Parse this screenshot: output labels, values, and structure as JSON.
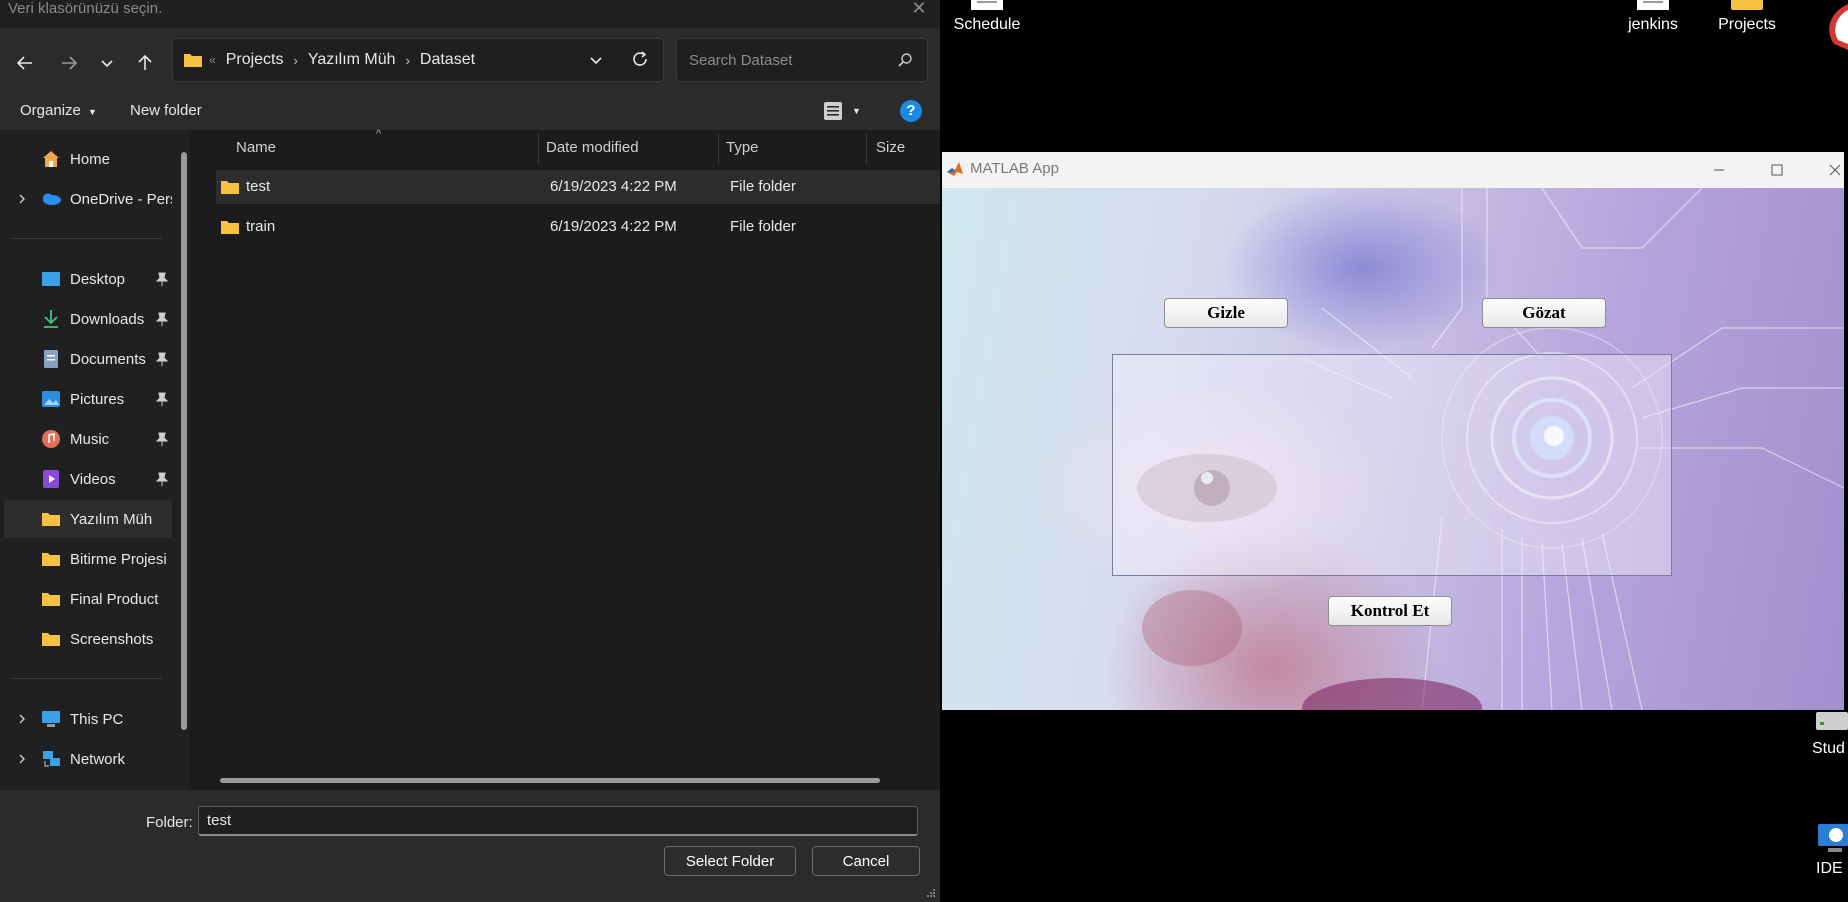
{
  "dialog": {
    "title": "Veri klasörünüzü seçin.",
    "breadcrumb": [
      "Projects",
      "Yazılım Müh",
      "Dataset"
    ],
    "search_placeholder": "Search Dataset",
    "toolbar": {
      "organize": "Organize",
      "new_folder": "New folder"
    },
    "sidebar": {
      "top": [
        {
          "label": "Home",
          "icon": "home-icon"
        },
        {
          "label": "OneDrive - Perso",
          "icon": "onedrive-icon"
        }
      ],
      "quick": [
        {
          "label": "Desktop",
          "icon": "desktop-icon"
        },
        {
          "label": "Downloads",
          "icon": "downloads-icon"
        },
        {
          "label": "Documents",
          "icon": "documents-icon"
        },
        {
          "label": "Pictures",
          "icon": "pictures-icon"
        },
        {
          "label": "Music",
          "icon": "music-icon"
        },
        {
          "label": "Videos",
          "icon": "videos-icon"
        },
        {
          "label": "Yazılım Müh",
          "icon": "folder-icon"
        },
        {
          "label": "Bitirme Projesi",
          "icon": "folder-icon"
        },
        {
          "label": "Final Product",
          "icon": "folder-icon"
        },
        {
          "label": "Screenshots",
          "icon": "folder-icon"
        }
      ],
      "bottom": [
        {
          "label": "This PC",
          "icon": "pc-icon"
        },
        {
          "label": "Network",
          "icon": "network-icon"
        }
      ]
    },
    "columns": [
      "Name",
      "Date modified",
      "Type",
      "Size"
    ],
    "rows": [
      {
        "name": "test",
        "date": "6/19/2023 4:22 PM",
        "type": "File folder",
        "size": ""
      },
      {
        "name": "train",
        "date": "6/19/2023 4:22 PM",
        "type": "File folder",
        "size": ""
      }
    ],
    "footer": {
      "folder_label": "Folder:",
      "folder_value": "test",
      "select_button": "Select Folder",
      "cancel_button": "Cancel"
    }
  },
  "matlab": {
    "title": "MATLAB App",
    "buttons": {
      "gizle": "Gizle",
      "gozat": "Gözat",
      "kontrol": "Kontrol Et"
    }
  },
  "desktop": {
    "icons": [
      "Schedule",
      "jenkins",
      "Projects",
      "Stud",
      "IDE"
    ]
  },
  "colors": {
    "accent": "#4aa3f0",
    "folder": "#f5c242",
    "dialog_bg": "#1c1c1c"
  }
}
